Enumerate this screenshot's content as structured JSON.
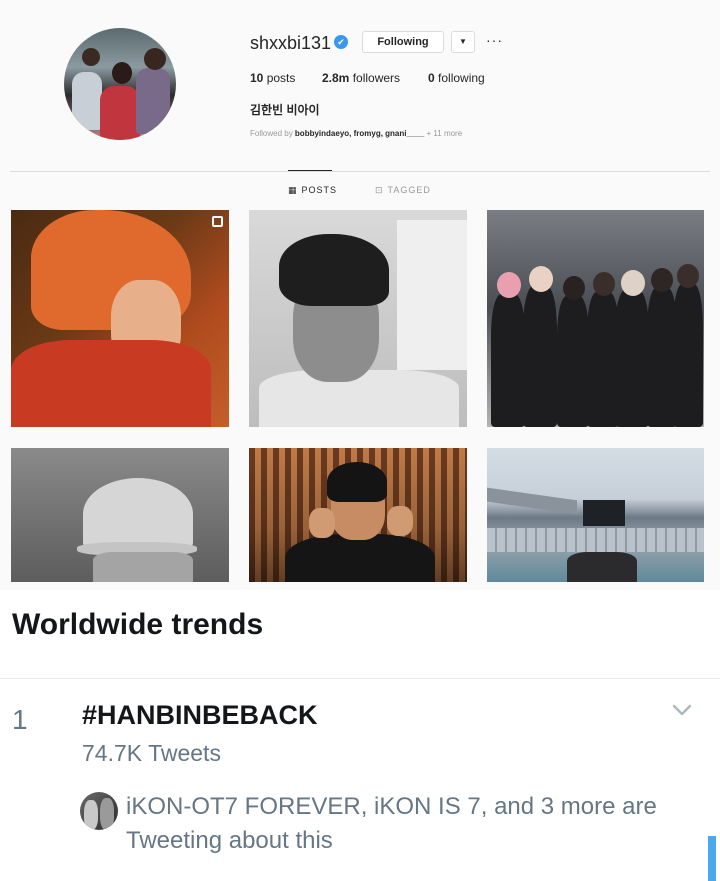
{
  "profile": {
    "username": "shxxbi131",
    "verified_mark": "✔",
    "follow_label": "Following",
    "dropdown_label": "▼",
    "more_label": "···",
    "posts_count": "10",
    "posts_label": "posts",
    "followers_count": "2.8m",
    "followers_label": "followers",
    "following_count": "0",
    "following_label": "following",
    "full_name": "김한빈 비아이",
    "followed_by_prefix": "Followed by",
    "followed_by_names": "bobbyindaeyo, fromyg, gnani____",
    "followed_by_more": "+ 11 more"
  },
  "tabs": [
    {
      "label": "POSTS",
      "icon": "grid-icon",
      "glyph": "▦",
      "active": true
    },
    {
      "label": "TAGGED",
      "icon": "tag-icon",
      "glyph": "⊡",
      "active": false
    }
  ],
  "trends": {
    "title": "Worldwide trends",
    "items": [
      {
        "rank": "1",
        "hashtag": "#HANBINBEBACK",
        "tweet_count": "74.7K Tweets",
        "context": "iKON-OT7 FOREVER, iKON IS 7, and 3 more are Tweeting about this"
      }
    ]
  },
  "colors": {
    "instagram_bg": "#fafafa",
    "verified_blue": "#3897f0",
    "twitter_text": "#14171a",
    "twitter_secondary": "#657786",
    "scrollbar": "#4aa8f0"
  },
  "icons": [
    "verified-badge-icon",
    "chevron-down-icon",
    "more-options-icon",
    "grid-icon",
    "tag-icon",
    "multiple-posts-icon",
    "caret-down-icon"
  ]
}
